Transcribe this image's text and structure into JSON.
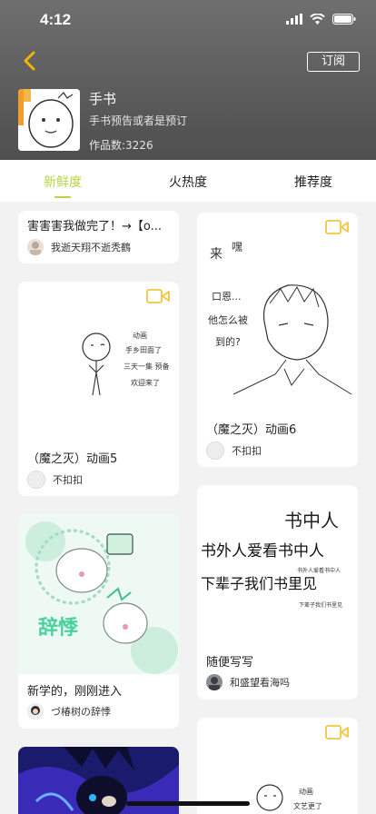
{
  "status": {
    "time": "4:12"
  },
  "header": {
    "subscribe_label": "订阅",
    "title": "手书",
    "description": "手书预告或者是预订",
    "works_count": "作品数:3226"
  },
  "tabs": [
    {
      "label": "新鲜度",
      "active": true
    },
    {
      "label": "火热度",
      "active": false
    },
    {
      "label": "推荐度",
      "active": false
    }
  ],
  "cards": {
    "c1": {
      "title": "害害害我做完了！→【o...",
      "author": "我逝天翔不逝秃鶴"
    },
    "c2": {
      "title": "（魔之灭）动画5",
      "author": "不扣扣",
      "video": true
    },
    "c3": {
      "title": "（魔之灭）动画6",
      "author": "不扣扣",
      "video": true
    },
    "c4": {
      "title": "新学的，刚刚进入",
      "author": "づ椿树の辞悸",
      "art_text": "辞悸"
    },
    "c5": {
      "title": "随便写写",
      "author": "和盛望看海吗",
      "art_lines": [
        "书中人",
        "书外人爱看书中人",
        "书外人爱看书中人",
        "下辈子我们书里见",
        "下辈子我们书里见"
      ]
    },
    "c6": {
      "video": true
    }
  },
  "art_notes": {
    "c2": [
      "动画",
      "手乡田面了",
      "三天一集 预备",
      "欢迎来了"
    ],
    "c3": [
      "来",
      "嘿",
      "口恩...",
      "他怎么被",
      "到的?"
    ],
    "c6": [
      "动画",
      "文艺更了"
    ]
  },
  "colors": {
    "accent": "#b5d642",
    "video_icon": "#f5c542"
  }
}
